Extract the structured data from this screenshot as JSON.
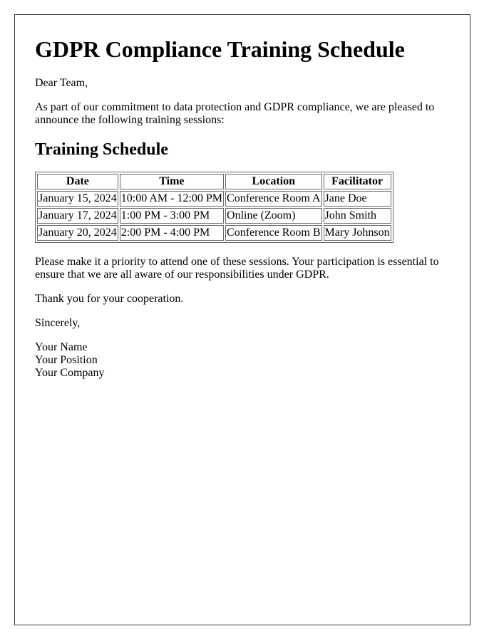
{
  "letter": {
    "title": "GDPR Compliance Training Schedule",
    "greeting": "Dear Team,",
    "intro": "As part of our commitment to data protection and GDPR compliance, we are pleased to announce the following training sessions:",
    "section_heading": "Training Schedule",
    "table": {
      "headers": [
        "Date",
        "Time",
        "Location",
        "Facilitator"
      ],
      "rows": [
        [
          "January 15, 2024",
          "10:00 AM - 12:00 PM",
          "Conference Room A",
          "Jane Doe"
        ],
        [
          "January 17, 2024",
          "1:00 PM - 3:00 PM",
          "Online (Zoom)",
          "John Smith"
        ],
        [
          "January 20, 2024",
          "2:00 PM - 4:00 PM",
          "Conference Room B",
          "Mary Johnson"
        ]
      ]
    },
    "closing": "Please make it a priority to attend one of these sessions. Your participation is essential to ensure that we are all aware of our responsibilities under GDPR.",
    "thanks": "Thank you for your cooperation.",
    "sign_off": "Sincerely,",
    "signature": {
      "name": "Your Name",
      "position": "Your Position",
      "company": "Your Company"
    }
  }
}
